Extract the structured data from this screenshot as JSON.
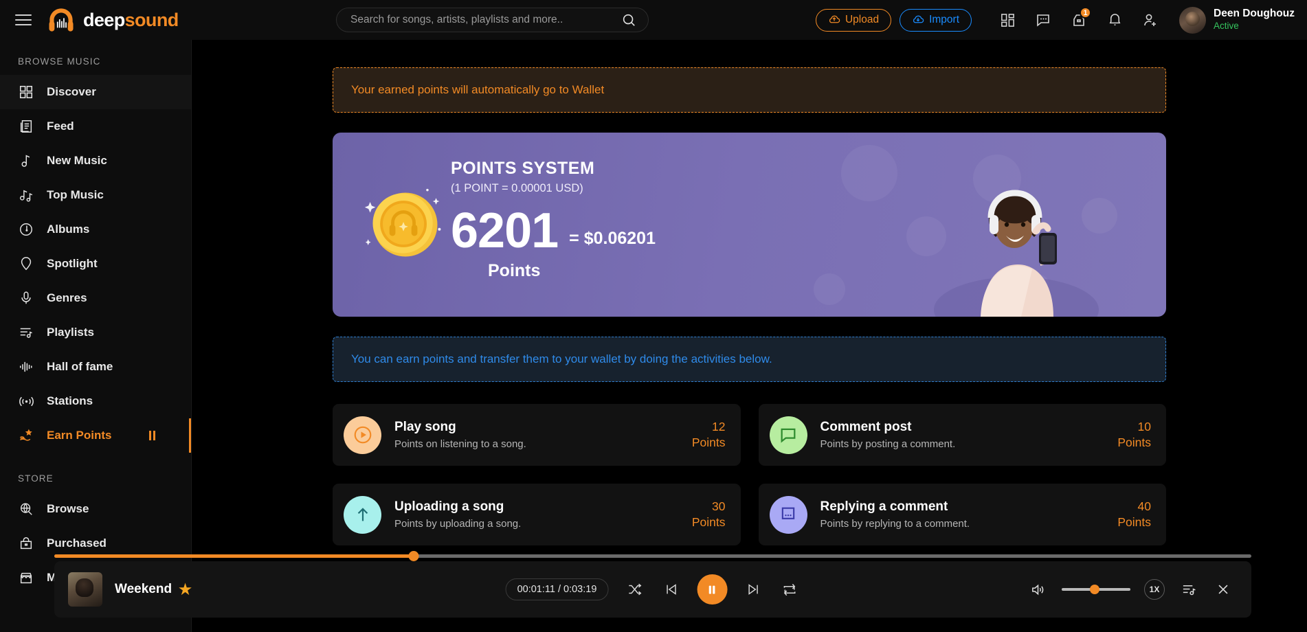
{
  "header": {
    "brand": {
      "first": "deep",
      "second": "sound"
    },
    "menu_icon": "hamburger-icon",
    "search": {
      "placeholder": "Search for songs, artists, playlists and more..",
      "value": "",
      "icon": "search-icon"
    },
    "upload_label": "Upload",
    "import_label": "Import",
    "icons": [
      "grid-apps-icon",
      "chat-bubble-icon",
      "inbox-icon",
      "bell-icon",
      "add-friend-icon"
    ],
    "inbox_badge": "1",
    "user": {
      "name": "Deen Doughouz",
      "status": "Active"
    },
    "accent": "#f28a25",
    "import_color": "#1a8cff",
    "status_color": "#35c45e"
  },
  "sidebar": {
    "section_browse": "BROWSE MUSIC",
    "section_store": "STORE",
    "browse_items": [
      {
        "label": "Discover",
        "icon": "grid-icon",
        "active": false
      },
      {
        "label": "Feed",
        "icon": "feed-icon",
        "active": false
      },
      {
        "label": "New Music",
        "icon": "music-note-icon",
        "active": false
      },
      {
        "label": "Top Music",
        "icon": "double-note-icon",
        "active": false
      },
      {
        "label": "Albums",
        "icon": "disc-icon",
        "active": false
      },
      {
        "label": "Spotlight",
        "icon": "pin-icon",
        "active": false
      },
      {
        "label": "Genres",
        "icon": "microphone-icon",
        "active": false
      },
      {
        "label": "Playlists",
        "icon": "playlist-icon",
        "active": false
      },
      {
        "label": "Hall of fame",
        "icon": "equalizer-icon",
        "active": false
      },
      {
        "label": "Stations",
        "icon": "broadcast-icon",
        "active": false
      },
      {
        "label": "Earn Points",
        "icon": "hand-star-icon",
        "active": true
      }
    ],
    "store_items": [
      {
        "label": "Browse",
        "icon": "globe-search-icon"
      },
      {
        "label": "Purchased",
        "icon": "bag-icon"
      },
      {
        "label": "Market",
        "icon": "store-icon"
      }
    ]
  },
  "main": {
    "warning_banner": "Your earned points will automatically go to Wallet",
    "info_banner": "You can earn points and transfer them to your wallet by doing the activities below.",
    "points_card": {
      "title": "POINTS SYSTEM",
      "subtitle": "(1 POINT = 0.00001 USD)",
      "points": "6201",
      "usd": "= $0.06201",
      "points_label": "Points",
      "bg_color": "#7a6fb4"
    },
    "activities": [
      {
        "title": "Play song",
        "desc": "Points on listening to a song.",
        "points": "12",
        "points_unit": "Points",
        "icon": "play-circle-icon",
        "icon_bg": "#fbcc9a",
        "icon_color": "#f28a25"
      },
      {
        "title": "Comment post",
        "desc": "Points by posting a comment.",
        "points": "10",
        "points_unit": "Points",
        "icon": "comment-icon",
        "icon_bg": "#b7eda0",
        "icon_color": "#2e8b2e"
      },
      {
        "title": "Uploading a song",
        "desc": "Points by uploading a song.",
        "points": "30",
        "points_unit": "Points",
        "icon": "upload-arrow-icon",
        "icon_bg": "#a8f0ec",
        "icon_color": "#1f6f74"
      },
      {
        "title": "Replying a comment",
        "desc": "Points by replying to a comment.",
        "points": "40",
        "points_unit": "Points",
        "icon": "reply-icon",
        "icon_bg": "#a9a9f5",
        "icon_color": "#3a3aa8"
      }
    ]
  },
  "player": {
    "track_title": "Weekend",
    "favorite_icon": "star-icon",
    "time": "00:01:11 / 0:03:19",
    "progress_percent": 30,
    "volume_percent": 48,
    "speed_label": "1X",
    "controls": [
      "shuffle-icon",
      "previous-icon",
      "pause-icon",
      "next-icon",
      "repeat-icon"
    ],
    "right_controls": [
      "volume-icon",
      "speed-button",
      "queue-icon",
      "close-icon"
    ],
    "accent": "#f28a25"
  }
}
